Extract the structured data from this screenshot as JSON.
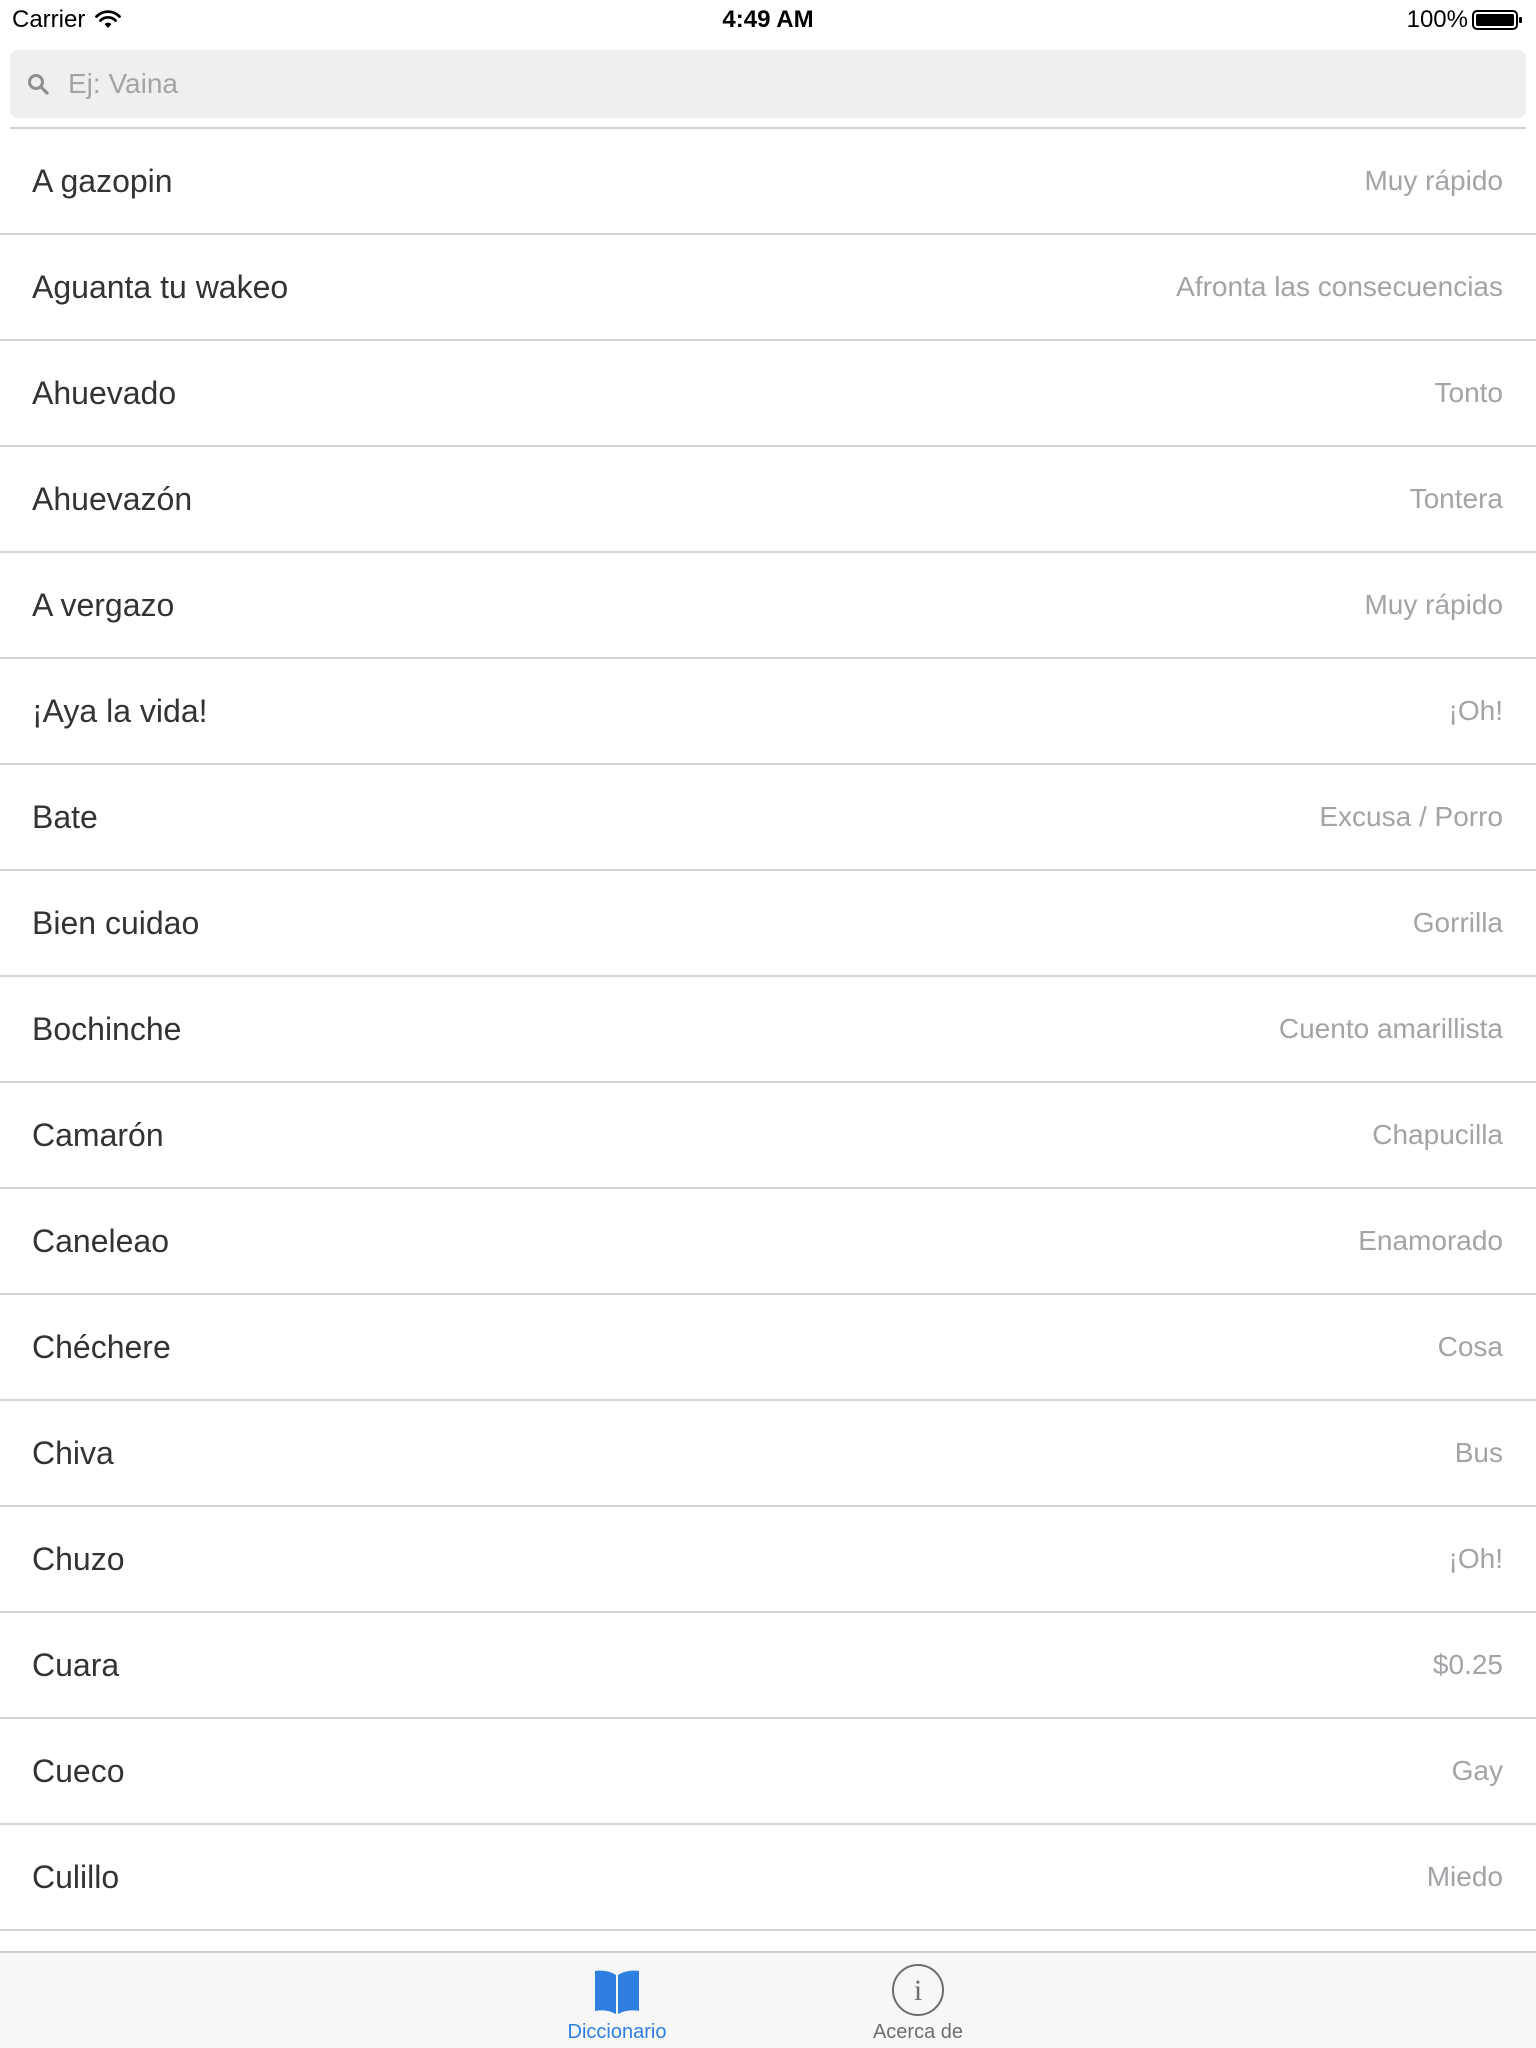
{
  "status_bar": {
    "carrier": "Carrier",
    "time": "4:49 AM",
    "battery": "100%"
  },
  "search": {
    "placeholder": "Ej: Vaina",
    "value": ""
  },
  "entries": [
    {
      "term": "A gazopin",
      "meaning": "Muy rápido"
    },
    {
      "term": "Aguanta tu wakeo",
      "meaning": "Afronta las consecuencias"
    },
    {
      "term": "Ahuevado",
      "meaning": "Tonto"
    },
    {
      "term": "Ahuevazón",
      "meaning": "Tontera"
    },
    {
      "term": "A vergazo",
      "meaning": "Muy rápido"
    },
    {
      "term": "¡Aya la vida!",
      "meaning": "¡Oh!"
    },
    {
      "term": "Bate",
      "meaning": "Excusa / Porro"
    },
    {
      "term": "Bien cuidao",
      "meaning": "Gorrilla"
    },
    {
      "term": "Bochinche",
      "meaning": "Cuento amarillista"
    },
    {
      "term": "Camarón",
      "meaning": "Chapucilla"
    },
    {
      "term": "Caneleao",
      "meaning": "Enamorado"
    },
    {
      "term": "Chéchere",
      "meaning": "Cosa"
    },
    {
      "term": "Chiva",
      "meaning": "Bus"
    },
    {
      "term": "Chuzo",
      "meaning": "¡Oh!"
    },
    {
      "term": "Cuara",
      "meaning": "$0.25"
    },
    {
      "term": "Cueco",
      "meaning": "Gay"
    },
    {
      "term": "Culillo",
      "meaning": "Miedo"
    }
  ],
  "tab_bar": {
    "tabs": [
      {
        "label": "Diccionario",
        "icon": "book-icon",
        "selected": true
      },
      {
        "label": "Acerca de",
        "icon": "info-icon",
        "selected": false
      }
    ]
  },
  "colors": {
    "accent": "#2f7fe0",
    "term_text": "#333336",
    "meaning_text": "#a3a3a8",
    "separator": "#d4d4d6",
    "search_bg": "#efeff0"
  }
}
